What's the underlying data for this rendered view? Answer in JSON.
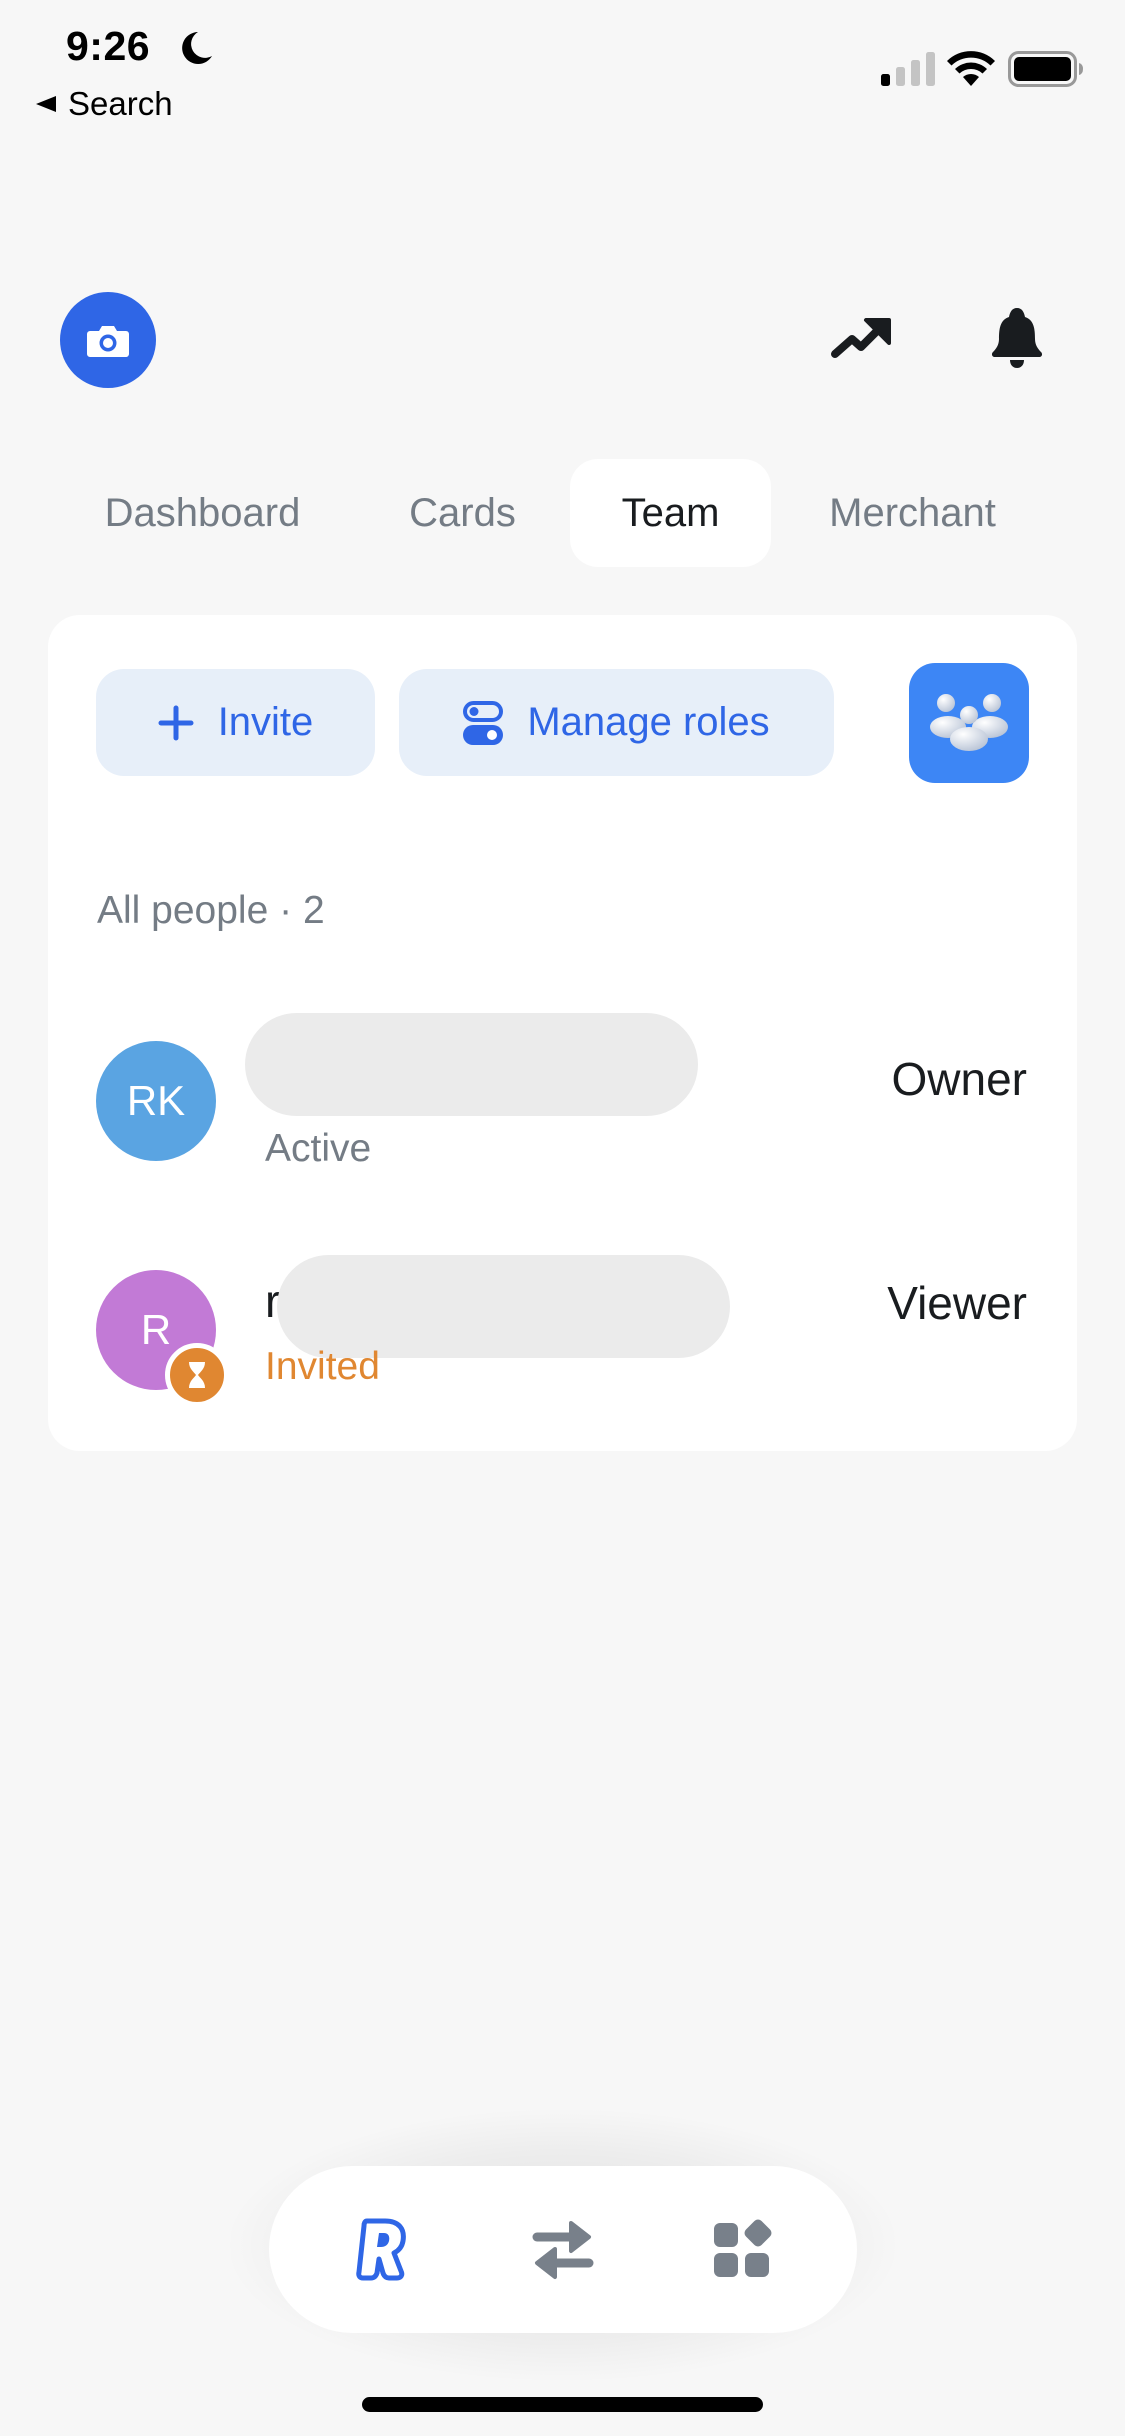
{
  "status_bar": {
    "time": "9:26",
    "focus_icon": "moon-icon",
    "back_label": "Search",
    "signal_bars_filled": 1,
    "signal_bars_total": 4,
    "wifi_icon": "wifi-icon",
    "battery_icon": "battery-icon"
  },
  "header": {
    "left_icon": "camera-icon",
    "right_icons": [
      "trending-up-icon",
      "bell-icon"
    ],
    "colors": {
      "accent": "#2f66e6"
    }
  },
  "tabs": [
    {
      "label": "Dashboard",
      "active": false
    },
    {
      "label": "Cards",
      "active": false
    },
    {
      "label": "Team",
      "active": true
    },
    {
      "label": "Merchant",
      "active": false
    }
  ],
  "team_card": {
    "actions": {
      "invite_label": "Invite",
      "manage_roles_label": "Manage roles",
      "team_icon": "team-people-icon"
    },
    "section_label": "All people · 2",
    "people": [
      {
        "initials": "RK",
        "name_visible": "",
        "status": "Active",
        "status_color": "#747c85",
        "role": "Owner",
        "avatar_color": "#5aa4e2",
        "badge": null
      },
      {
        "initials": "R",
        "name_visible": "r",
        "status": "Invited",
        "status_color": "#e08731",
        "role": "Viewer",
        "avatar_color": "#c27ad6",
        "badge": "hourglass-icon"
      }
    ]
  },
  "bottom_nav": {
    "items": [
      {
        "name": "home",
        "icon": "revolut-r-icon",
        "active": true
      },
      {
        "name": "transfers",
        "icon": "swap-arrows-icon",
        "active": false
      },
      {
        "name": "hub",
        "icon": "apps-grid-icon",
        "active": false
      }
    ],
    "colors": {
      "active": "#2f66e6",
      "inactive": "#78808a"
    }
  }
}
